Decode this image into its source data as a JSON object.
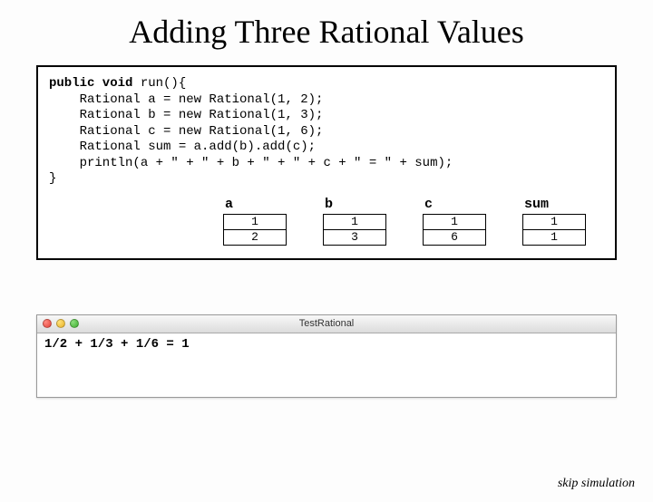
{
  "title": "Adding Three Rational Values",
  "code": {
    "line1_kw": "public void",
    "line1_rest": " run(){",
    "line2": "    Rational a = new Rational(1, 2);",
    "line3": "    Rational b = new Rational(1, 3);",
    "line4": "    Rational c = new Rational(1, 6);",
    "line5": "    Rational sum = a.add(b).add(c);",
    "line6": "    println(a + \" + \" + b + \" + \" + c + \" = \" + sum);",
    "line7": "}"
  },
  "vars": [
    {
      "label": "a",
      "num": "1",
      "den": "2"
    },
    {
      "label": "b",
      "num": "1",
      "den": "3"
    },
    {
      "label": "c",
      "num": "1",
      "den": "6"
    },
    {
      "label": "sum",
      "num": "1",
      "den": "1"
    }
  ],
  "console": {
    "title": "TestRational",
    "output": "1/2 + 1/3 + 1/6 = 1"
  },
  "skip_label": "skip simulation"
}
